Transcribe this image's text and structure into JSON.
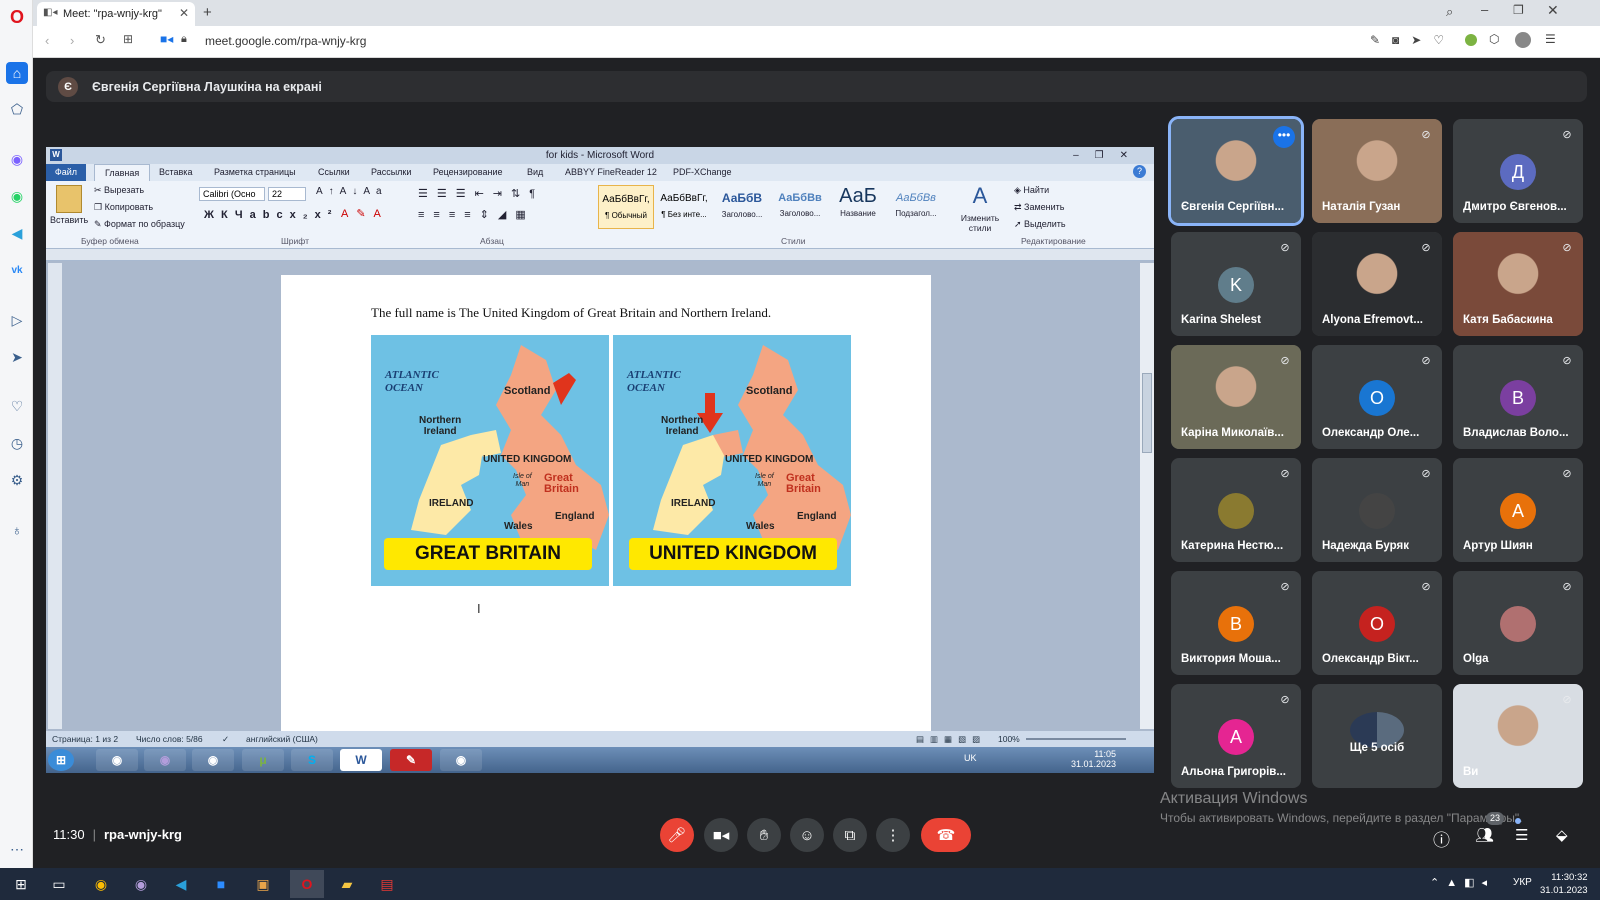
{
  "browser": {
    "tab_title": "Meet: \"rpa-wnjy-krg\"",
    "url": "meet.google.com/rpa-wnjy-krg"
  },
  "banner": {
    "avatar_letter": "Є",
    "text": "Євгенія Сергіївна Лаушкіна на екрані"
  },
  "word": {
    "title": "for kids  -  Microsoft Word",
    "tabs": [
      "Файл",
      "Главная",
      "Вставка",
      "Разметка страницы",
      "Ссылки",
      "Рассылки",
      "Рецензирование",
      "Вид",
      "ABBYY FineReader 12",
      "PDF-XChange"
    ],
    "clipboard": {
      "paste": "Вставить",
      "cut": "Вырезать",
      "copy": "Копировать",
      "format": "Формат по образцу",
      "group": "Буфер обмена"
    },
    "font": {
      "name": "Calibri (Осно",
      "size": "22",
      "group": "Шрифт"
    },
    "paragraph_group": "Абзац",
    "styles": [
      {
        "sample": "АаБбВвГг,",
        "label": "¶ Обычный"
      },
      {
        "sample": "АаБбВвГг,",
        "label": "¶ Без инте..."
      },
      {
        "sample": "АаБбВ",
        "label": "Заголово..."
      },
      {
        "sample": "АаБбВв",
        "label": "Заголово..."
      },
      {
        "sample": "АаБ",
        "label": "Название"
      },
      {
        "sample": "АаБбВв",
        "label": "Подзагол..."
      }
    ],
    "change_styles": "Изменить стили",
    "styles_group": "Стили",
    "editing": {
      "find": "Найти",
      "replace": "Заменить",
      "select": "Выделить",
      "group": "Редактирование"
    },
    "document_text": "The full name is  The United Kingdom of Great Britain and Northern Ireland.",
    "maps": {
      "ocean": [
        "ATLANTIC",
        "OCEAN"
      ],
      "scotland": "Scotland",
      "northern_ireland": [
        "Northern",
        "Ireland"
      ],
      "uk": "UNITED KINGDOM",
      "ireland": "IRELAND",
      "isle_of_man": [
        "Isle of",
        "Man"
      ],
      "great_britain": [
        "Great",
        "Britain"
      ],
      "wales": "Wales",
      "england": "England",
      "left_banner": "GREAT BRITAIN",
      "right_banner": "UNITED KINGDOM"
    },
    "status": {
      "page": "Страница: 1 из 2",
      "words": "Число слов: 5/86",
      "lang": "английский (США)",
      "zoom": "100%"
    },
    "taskbar": {
      "lang": "UK",
      "time": "11:05",
      "date": "31.01.2023"
    }
  },
  "participants": [
    {
      "name": "Євгенія Сергіївн...",
      "type": "video",
      "color": "#4a5d6e",
      "speaking": true
    },
    {
      "name": "Наталія Гузан",
      "type": "video",
      "color": "#8a6e58"
    },
    {
      "name": "Дмитро Євгенов...",
      "type": "avatar",
      "letter": "Д",
      "color": "#5c6bc0"
    },
    {
      "name": "Karina Shelest",
      "type": "avatar",
      "letter": "K",
      "color": "#607d8b"
    },
    {
      "name": "Alyona Efremovt...",
      "type": "video",
      "color": "#2b2d30"
    },
    {
      "name": "Катя Бабаскина",
      "type": "video",
      "color": "#7a4a3a"
    },
    {
      "name": "Каріна Миколаїв...",
      "type": "video",
      "color": "#6b6a58"
    },
    {
      "name": "Олександр Оле...",
      "type": "avatar",
      "letter": "О",
      "color": "#1976d2"
    },
    {
      "name": "Владислав Воло...",
      "type": "avatar",
      "letter": "В",
      "color": "#7b3fa0"
    },
    {
      "name": "Катерина Нестю...",
      "type": "photo",
      "color": "#8a7a30"
    },
    {
      "name": "Надежда Буряк",
      "type": "photo",
      "color": "#444"
    },
    {
      "name": "Артур Шиян",
      "type": "avatar",
      "letter": "А",
      "color": "#e8710a"
    },
    {
      "name": "Виктория Моша...",
      "type": "avatar",
      "letter": "В",
      "color": "#e8710a"
    },
    {
      "name": "Олександр Вікт...",
      "type": "avatar",
      "letter": "О",
      "color": "#c5221f"
    },
    {
      "name": "Olga",
      "type": "photo",
      "color": "#b07070"
    },
    {
      "name": "Альона Григорів...",
      "type": "avatar",
      "letter": "А",
      "color": "#e52592"
    },
    {
      "name": "Ще 5 осіб",
      "type": "more",
      "color": "#3c4043"
    },
    {
      "name": "Ви",
      "type": "video",
      "color": "#d8dde3"
    }
  ],
  "meeting": {
    "time": "11:30",
    "code": "rpa-wnjy-krg",
    "people_count": "23"
  },
  "watermark": {
    "title": "Активация Windows",
    "subtitle": "Чтобы активировать Windows, перейдите в раздел \"Параметры\"."
  },
  "system_tray": {
    "lang": "УКР",
    "time": "11:30:32",
    "date": "31.01.2023"
  },
  "colors": {
    "accent": "#8ab4f8",
    "end_call": "#ea4335",
    "map_sea": "#6ec1e4",
    "banner_yellow": "#ffe800"
  }
}
